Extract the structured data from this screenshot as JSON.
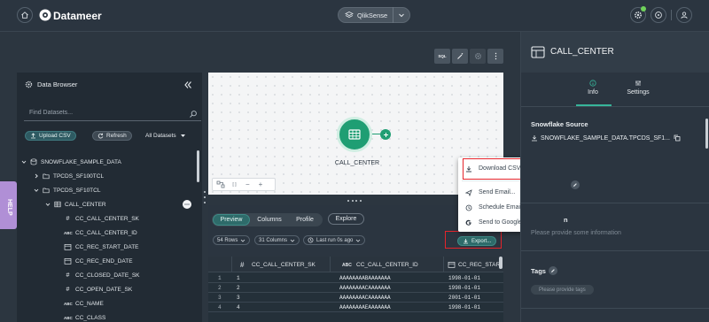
{
  "app": {
    "name": "Datameer"
  },
  "header": {
    "project": "QlikSense"
  },
  "help": {
    "label": "HELP"
  },
  "data_browser": {
    "title": "Data Browser",
    "search_placeholder": "Find Datasets...",
    "upload_label": "Upload CSV",
    "refresh_label": "Refresh",
    "filter_label": "All Datasets",
    "tree": [
      {
        "label": "SNOWFLAKE_SAMPLE_DATA",
        "kind": "database",
        "expanded": true
      },
      {
        "label": "TPCDS_SF100TCL",
        "kind": "schema",
        "expanded": false
      },
      {
        "label": "TPCDS_SF10TCL",
        "kind": "schema",
        "expanded": true
      },
      {
        "label": "CALL_CENTER",
        "kind": "table",
        "expanded": true
      },
      {
        "label": "CC_CALL_CENTER_SK",
        "kind": "number"
      },
      {
        "label": "CC_CALL_CENTER_ID",
        "kind": "text"
      },
      {
        "label": "CC_REC_START_DATE",
        "kind": "date"
      },
      {
        "label": "CC_REC_END_DATE",
        "kind": "date"
      },
      {
        "label": "CC_CLOSED_DATE_SK",
        "kind": "number"
      },
      {
        "label": "CC_OPEN_DATE_SK",
        "kind": "number"
      },
      {
        "label": "CC_NAME",
        "kind": "text"
      },
      {
        "label": "CC_CLASS",
        "kind": "text"
      }
    ]
  },
  "canvas": {
    "node_label": "CALL_CENTER",
    "toolbar": {
      "sql": "SQL"
    },
    "zoom_tools": {
      "fit": "⟦⟧",
      "minus": "−",
      "plus": "+"
    }
  },
  "results": {
    "tabs": [
      "Preview",
      "Columns",
      "Profile"
    ],
    "active_tab": "Preview",
    "explore_label": "Explore",
    "rows_filter": "54 Rows",
    "columns_filter": "31 Columns",
    "last_run": "Last run 0s ago",
    "export_label": "Export...",
    "grid": {
      "columns": [
        {
          "type": "#",
          "name": "CC_CALL_CENTER_SK"
        },
        {
          "type": "ABC",
          "name": "CC_CALL_CENTER_ID"
        },
        {
          "type": "date",
          "name": "CC_REC_STAR"
        }
      ],
      "rows": [
        {
          "n": "1",
          "c1": "1",
          "c2": "AAAAAAAABAAAAAAA",
          "c3": "1998-01-01"
        },
        {
          "n": "2",
          "c1": "2",
          "c2": "AAAAAAAACAAAAAAA",
          "c3": "1998-01-01"
        },
        {
          "n": "3",
          "c1": "3",
          "c2": "AAAAAAAACAAAAAAA",
          "c3": "2001-01-01"
        },
        {
          "n": "4",
          "c1": "4",
          "c2": "AAAAAAAAEAAAAAAA",
          "c3": "1998-01-01"
        }
      ]
    }
  },
  "export_menu": {
    "items": [
      "Download CSV",
      "Send Email...",
      "Schedule Email...",
      "Send to Google Sheets..."
    ]
  },
  "inspector": {
    "title": "CALL_CENTER",
    "tabs": {
      "info": "Info",
      "settings": "Settings"
    },
    "source_title": "Snowflake Source",
    "source_path": "SNOWFLAKE_SAMPLE_DATA.TPCDS_SF1...",
    "description_text": "Please provide some information",
    "description_suffix": "n",
    "tags_title": "Tags",
    "tags_placeholder": "Please provide tags"
  },
  "colors": {
    "accent": "#1f9e73",
    "highlight_border": "#e5242b",
    "panel_dark": "#222b34",
    "background": "#2c3640"
  }
}
